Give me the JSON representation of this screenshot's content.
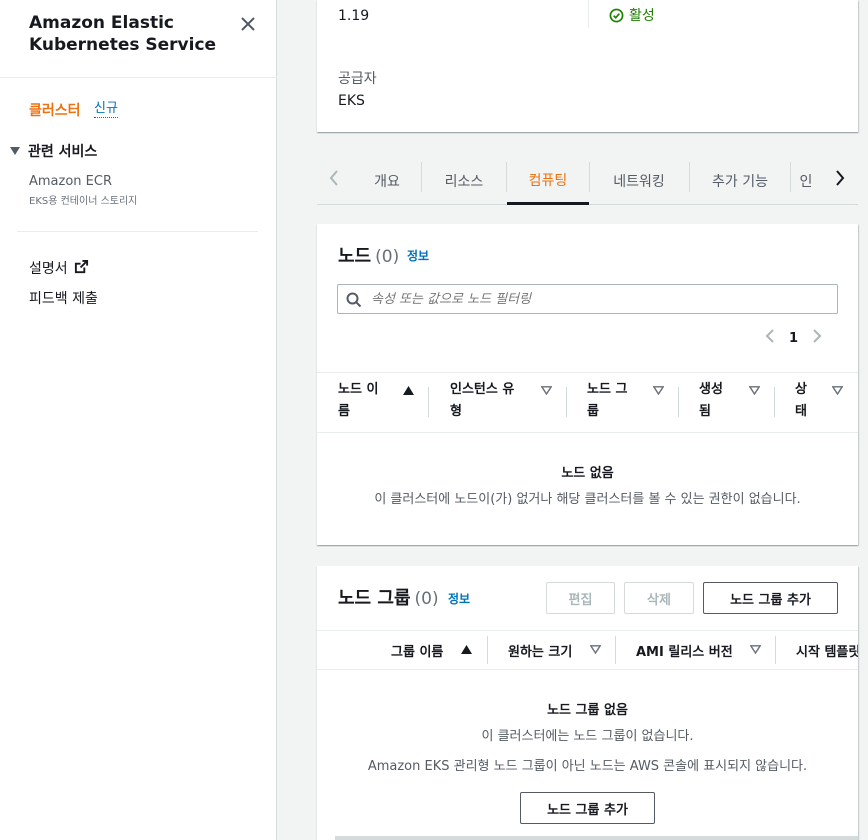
{
  "sidebar": {
    "title": "Amazon Elastic Kubernetes Service",
    "clusters_label": "클러스터",
    "new_badge": "신규",
    "related_services_label": "관련 서비스",
    "ecr_label": "Amazon ECR",
    "ecr_sub": "EKS용 컨테이너 스토리지",
    "docs_label": "설명서",
    "feedback_label": "피드백 제출"
  },
  "cluster_info": {
    "version": "1.19",
    "status": "활성",
    "provider_label": "공급자",
    "provider_value": "EKS"
  },
  "tabs": [
    {
      "label": "개요"
    },
    {
      "label": "리소스"
    },
    {
      "label": "컴퓨팅"
    },
    {
      "label": "네트워킹"
    },
    {
      "label": "추가 기능"
    },
    {
      "label": "인"
    }
  ],
  "nodes": {
    "title": "노드",
    "count": "(0)",
    "info": "정보",
    "search_placeholder": "속성 또는 값으로 노드 필터링",
    "page": "1",
    "columns": [
      {
        "line1": "노드 이",
        "line2": "름"
      },
      {
        "line1": "인스턴스 유",
        "line2": "형"
      },
      {
        "line1": "노드 그",
        "line2": "룹"
      },
      {
        "line1": "생성",
        "line2": "됨"
      },
      {
        "line1": "상",
        "line2": "태"
      }
    ],
    "empty_title": "노드 없음",
    "empty_desc": "이 클러스터에 노드이(가) 없거나 해당 클러스터를 볼 수 있는 권한이 없습니다."
  },
  "node_groups": {
    "title": "노드 그룹",
    "count": "(0)",
    "info": "정보",
    "edit_label": "편집",
    "delete_label": "삭제",
    "add_label": "노드 그룹 추가",
    "columns": [
      "그룹 이름",
      "원하는 크기",
      "AMI 릴리스 버전",
      "시작 템플릿"
    ],
    "empty_title": "노드 그룹 없음",
    "empty_desc": "이 클러스터에는 노드 그룹이 없습니다.",
    "empty_note": "Amazon EKS 관리형 노드 그룹이 아닌 노드는 AWS 콘솔에 표시되지 않습니다.",
    "empty_add_label": "노드 그룹 추가"
  },
  "colors": {
    "accent": "#ec7211",
    "link": "#0073bb",
    "success": "#1d8102"
  }
}
